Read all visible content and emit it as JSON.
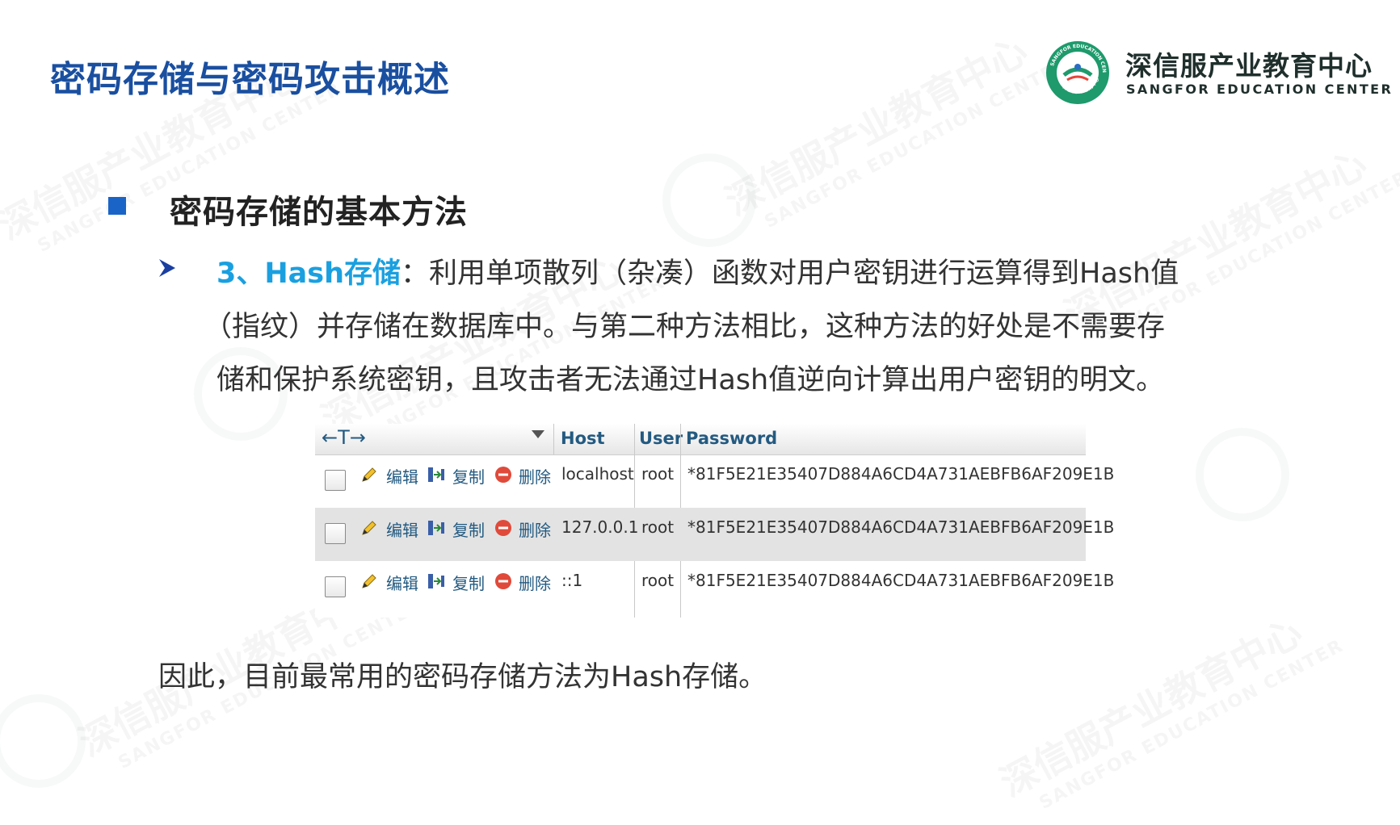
{
  "slide": {
    "title": "密码存储与密码攻击概述",
    "heading": "密码存储的基本方法",
    "point": {
      "highlight": "3、Hash存储",
      "line1": "：利用单项散列（杂凑）函数对用户密钥进行运算得到Hash值",
      "line2": "（指纹）并存储在数据库中。与第二种方法相比，这种方法的好处是不需要存",
      "line3": "储和保护系统密钥，且攻击者无法通过Hash值逆向计算出用户密钥的明文。"
    },
    "conclusion": "因此，目前最常用的密码存储方法为Hash存储。"
  },
  "logo": {
    "name_zh": "深信服产业教育中心",
    "name_en": "SANGFOR EDUCATION CENTER",
    "badge_arc_top": "SANGFOR EDUCATION CENTER",
    "badge_arc_bottom": "深信服产业教育中心"
  },
  "watermark": {
    "zh": "深信服产业教育中心",
    "en": "SANGFOR EDUCATION CENTER"
  },
  "table": {
    "nav_label": "←T→",
    "columns": [
      "Host",
      "User",
      "Password"
    ],
    "actions": {
      "edit": "编辑",
      "copy": "复制",
      "delete": "删除"
    },
    "rows": [
      {
        "host": "localhost",
        "user": "root",
        "password": "*81F5E21E35407D884A6CD4A731AEBFB6AF209E1B"
      },
      {
        "host": "127.0.0.1",
        "user": "root",
        "password": "*81F5E21E35407D884A6CD4A731AEBFB6AF209E1B"
      },
      {
        "host": "::1",
        "user": "root",
        "password": "*81F5E21E35407D884A6CD4A731AEBFB6AF209E1B"
      }
    ]
  },
  "colors": {
    "title": "#1a4fa0",
    "highlight": "#1aa0e0",
    "bullet": "#1a64c8",
    "logo_green": "#1e9a6c",
    "link": "#235a81"
  },
  "icons": {
    "bullet": "square-bullet-icon",
    "point_bullet": "arrowhead-bullet-icon",
    "edit": "pencil-icon",
    "copy": "copy-icon",
    "delete": "delete-icon",
    "sort": "sort-down-icon"
  }
}
